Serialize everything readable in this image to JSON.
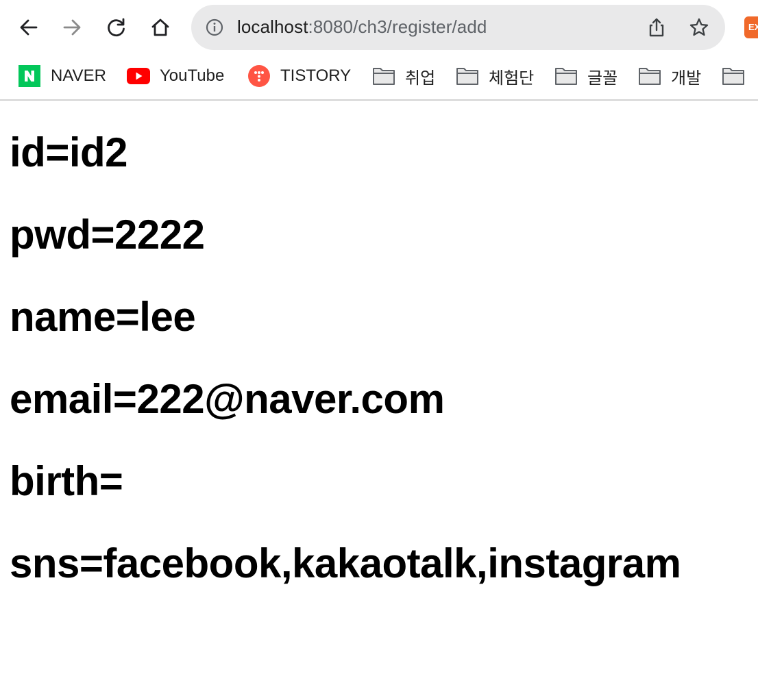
{
  "browser": {
    "url_host": "localhost",
    "url_path": ":8080/ch3/register/add",
    "extension_label": "EX"
  },
  "bookmarks": [
    {
      "label": "NAVER",
      "icon": "naver-icon"
    },
    {
      "label": "YouTube",
      "icon": "youtube-icon"
    },
    {
      "label": "TISTORY",
      "icon": "tistory-icon"
    },
    {
      "label": "취업",
      "icon": "folder-icon"
    },
    {
      "label": "체험단",
      "icon": "folder-icon"
    },
    {
      "label": "글꼴",
      "icon": "folder-icon"
    },
    {
      "label": "개발",
      "icon": "folder-icon"
    },
    {
      "label": "",
      "icon": "folder-icon"
    }
  ],
  "page": {
    "lines": [
      "id=id2",
      "pwd=2222",
      "name=lee",
      "email=222@naver.com",
      "birth=",
      "sns=facebook,kakaotalk,instagram"
    ]
  },
  "colors": {
    "naver": "#03c75a",
    "youtube": "#ff0000",
    "tistory": "#ff5544",
    "omnibox": "#e9e9ea"
  }
}
